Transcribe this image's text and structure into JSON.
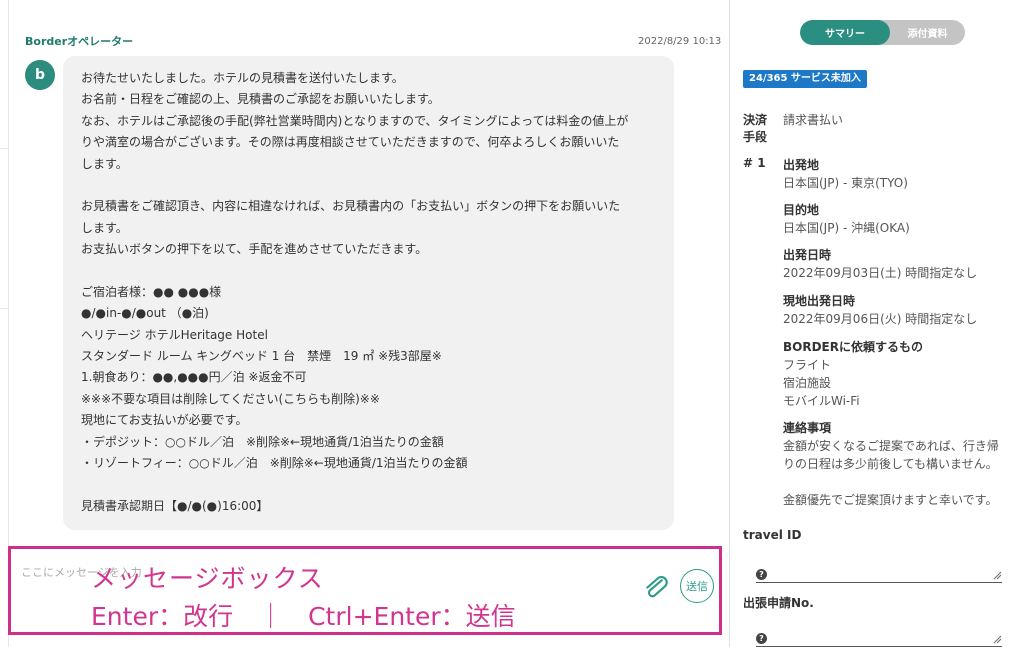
{
  "message": {
    "sender": "Borderオペレーター",
    "timestamp": "2022/8/29 10:13",
    "avatar_letter": "b",
    "lines": [
      "お待たせいたしました。ホテルの見積書を送付いたします。",
      "お名前・日程をご確認の上、見積書のご承認をお願いいたします。",
      "なお、ホテルはご承認後の手配(弊社営業時間内)となりますので、タイミングによっては料金の値上が",
      "りや満室の場合がございます。その際は再度相談させていただきますので、何卒よろしくお願いいた",
      "します。",
      "",
      "お見積書をご確認頂き、内容に相違なければ、お見積書内の「お支払い」ボタンの押下をお願いいた",
      "します。",
      "お支払いボタンの押下を以て、手配を進めさせていただきます。",
      "",
      "ご宿泊者様：●● ●●●様",
      "●/●in-●/●out （●泊)",
      "ヘリテージ ホテルHeritage Hotel",
      "スタンダード ルーム キングベッド 1 台　禁煙　19 ㎡ ※残3部屋※",
      "1.朝食あり：●●,●●●円／泊 ※返金不可",
      "※※※不要な項目は削除してください(こちらも削除)※※",
      "現地にてお支払いが必要です。",
      "・デポジット：○○ドル／泊　※削除※←現地通貨/1泊当たりの金額",
      "・リゾートフィー：○○ドル／泊　※削除※←現地通貨/1泊当たりの金額",
      "",
      "見積書承認期日【●/●(●)16:00】"
    ]
  },
  "compose": {
    "placeholder": "ここにメッセージを入力",
    "hint_line1": "メッセージボックス",
    "hint_line2": "Enter：改行　｜　Ctrl+Enter：送信",
    "send_label": "送信"
  },
  "sidebar": {
    "tabs": {
      "summary": "サマリー",
      "attachments": "添付資料"
    },
    "service_badge": "24/365 サービス未加入",
    "payment_label_1": "決済",
    "payment_label_2": "手段",
    "payment_value": "請求書払い",
    "trip_index": "# 1",
    "departure_title": "出発地",
    "departure_value": "日本国(JP) - 東京(TYO)",
    "destination_title": "目的地",
    "destination_value": "日本国(JP) - 沖縄(OKA)",
    "depart_datetime_title": "出発日時",
    "depart_datetime_value": "2022年09月03日(土) 時間指定なし",
    "return_datetime_title": "現地出発日時",
    "return_datetime_value": "2022年09月06日(火) 時間指定なし",
    "request_title": "BORDERに依頼するもの",
    "request_items": [
      "フライト",
      "宿泊施設",
      "モバイルWi-Fi"
    ],
    "notes_title": "連絡事項",
    "notes_lines": [
      "金額が安くなるご提案であれば、行き帰",
      "りの日程は多少前後しても構いません。",
      "",
      "金額優先でご提案頂けますと幸いです。"
    ],
    "travel_id_label": "travel ID",
    "trip_request_label": "出張申請No."
  },
  "colors": {
    "accent": "#2a8f80",
    "badge": "#1e78c8",
    "highlight": "#cf2f8a"
  }
}
